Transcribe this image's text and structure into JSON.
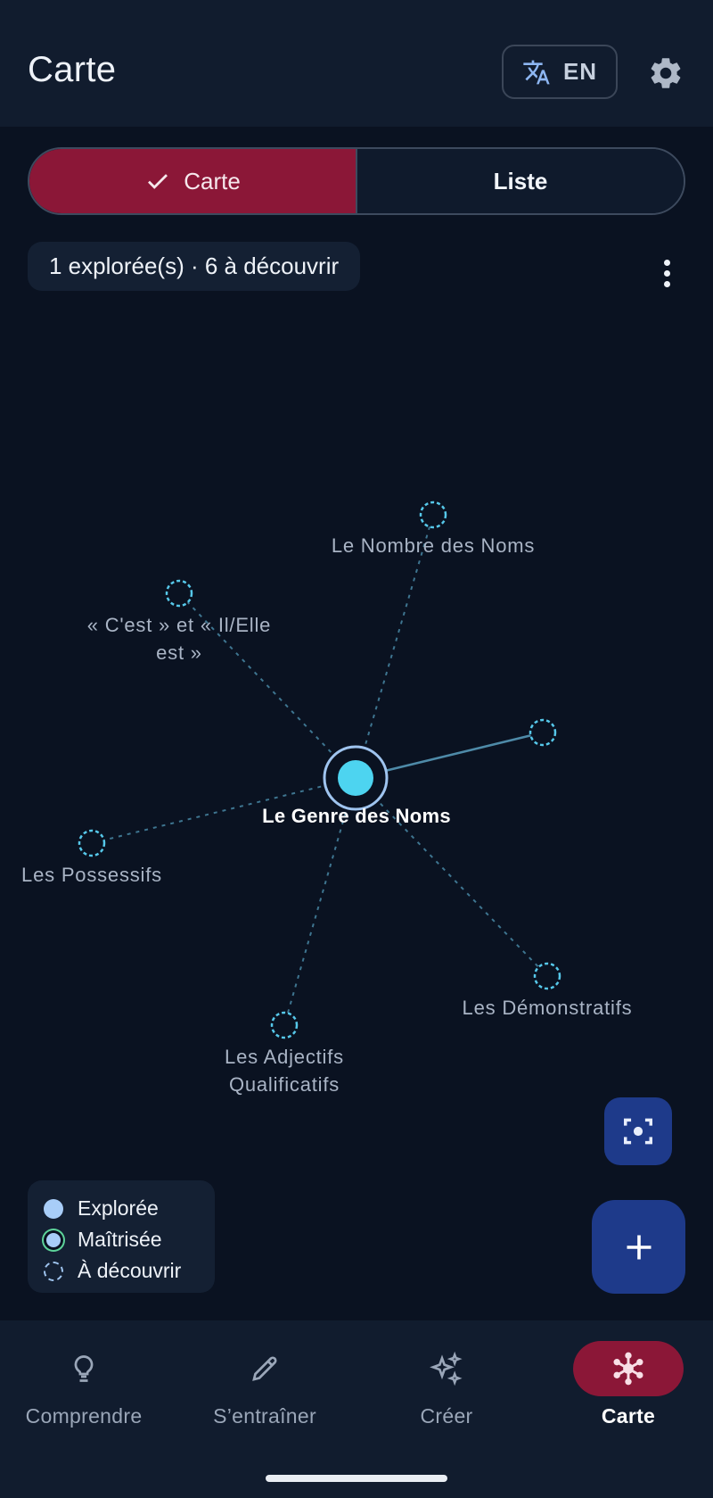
{
  "appbar": {
    "title": "Carte",
    "language_label": "EN",
    "translate_icon": "translate-icon",
    "settings_icon": "gear-icon"
  },
  "view_toggle": {
    "active_label": "Carte",
    "inactive_label": "Liste"
  },
  "stats": {
    "summary": "1 explorée(s) · 6 à découvrir"
  },
  "map": {
    "center": {
      "label": "Le Genre des Noms",
      "status": "explored"
    },
    "nodes": [
      {
        "label_lines": [
          "Le Nombre des Noms"
        ],
        "status": "to_discover"
      },
      {
        "label_lines": [
          "« C'est » et « Il/Elle",
          "est »"
        ],
        "status": "to_discover"
      },
      {
        "label_lines": [],
        "status": "to_discover"
      },
      {
        "label_lines": [
          "Les Possessifs"
        ],
        "status": "to_discover"
      },
      {
        "label_lines": [
          "Les Démonstratifs"
        ],
        "status": "to_discover"
      },
      {
        "label_lines": [
          "Les Adjectifs",
          "Qualificatifs"
        ],
        "status": "to_discover"
      }
    ]
  },
  "legend": {
    "explored": "Explorée",
    "mastered": "Maîtrisée",
    "to_discover": "À découvrir"
  },
  "fabs": {
    "recenter_icon": "focus-center-icon",
    "add_icon": "plus-icon"
  },
  "bottom_nav": [
    {
      "label": "Comprendre",
      "icon": "lightbulb-icon"
    },
    {
      "label": "S’entraîner",
      "icon": "pencil-icon"
    },
    {
      "label": "Créer",
      "icon": "sparkle-icon"
    },
    {
      "label": "Carte",
      "icon": "network-icon"
    }
  ],
  "colors": {
    "accent": "#8b1737",
    "node_explored": "#4dd4f0",
    "node_ring": "#9fc4ef",
    "fab": "#1e3a8a"
  }
}
